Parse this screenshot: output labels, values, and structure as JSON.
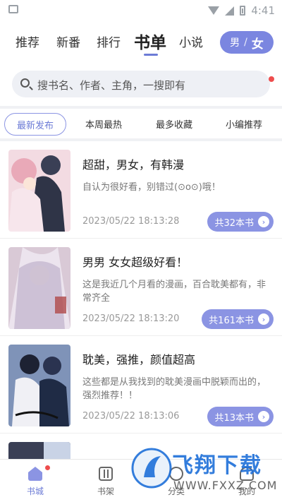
{
  "status_bar": {
    "time": "4:41"
  },
  "top_tabs": [
    "推荐",
    "新番",
    "排行",
    "书单",
    "小说"
  ],
  "active_top_tab": "书单",
  "gender_toggle": {
    "male": "男",
    "separator": "/",
    "female": "女"
  },
  "search": {
    "placeholder": "搜书名、作者、主角，一搜即有"
  },
  "filters": [
    "最新发布",
    "本周最热",
    "最多收藏",
    "小编推荐"
  ],
  "active_filter": "最新发布",
  "booklists": [
    {
      "title": "超甜，男女，有韩漫",
      "desc": "自认为很好看，别错过(⊙o⊙)哦！",
      "time": "2023/05/22 18:13:28",
      "count": "共32本书"
    },
    {
      "title": "男男  女女超级好看！",
      "desc": "这是我近几个月看的漫画，百合耽美都有，非常齐全",
      "time": "2023/05/22 18:13:20",
      "count": "共161本书"
    },
    {
      "title": "耽美，强推，颜值超高",
      "desc": "这些都是从我找到的耽美漫画中脱颖而出的，强烈推荐！！",
      "time": "2023/05/22 18:13:06",
      "count": "共13本书"
    }
  ],
  "bottom_nav": [
    {
      "label": "书城",
      "icon": "home-icon"
    },
    {
      "label": "书架",
      "icon": "bookshelf-icon"
    },
    {
      "label": "分类",
      "icon": "category-icon"
    },
    {
      "label": "我的",
      "icon": "profile-icon"
    }
  ],
  "watermark": {
    "text": "飞翔下载",
    "url": "WWW.FXXZ.COM"
  },
  "colors": {
    "accent": "#8b94e3",
    "accent_text": "#6c7bd6",
    "badge_red": "#ee4d4d"
  }
}
